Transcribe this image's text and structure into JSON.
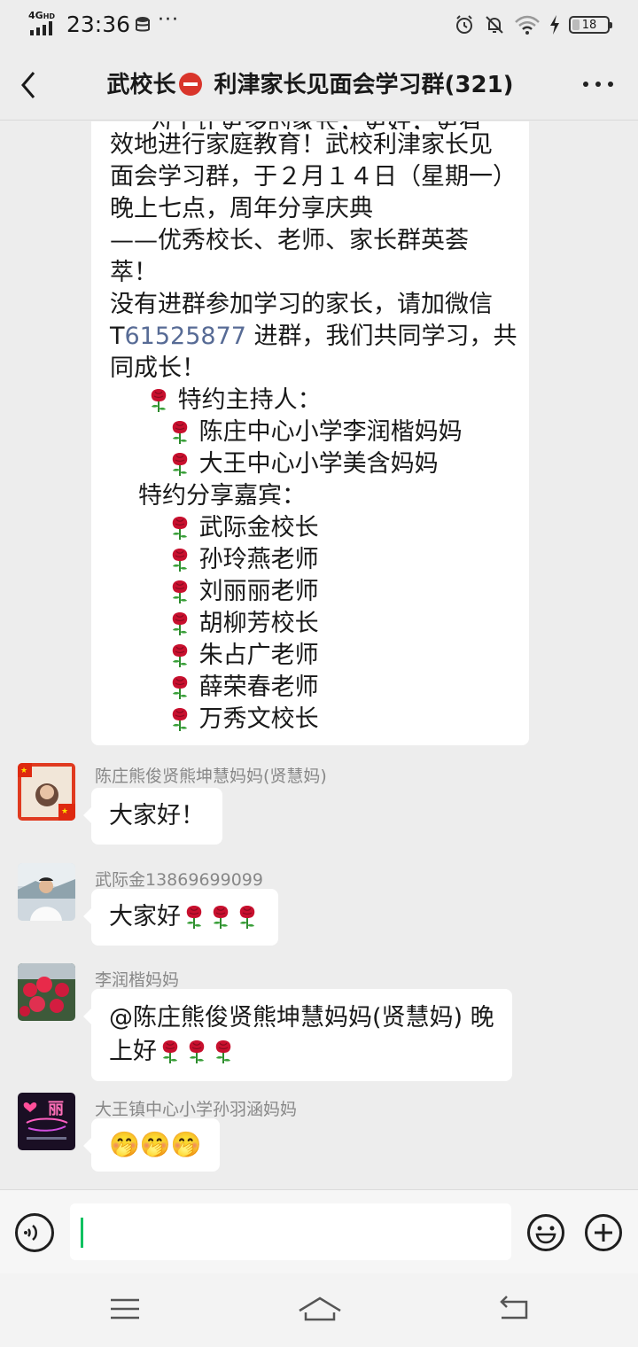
{
  "status_bar": {
    "network": "4G",
    "network_sup": "HD",
    "time": "23:36",
    "battery": "18",
    "battery_level": 0.18
  },
  "header": {
    "title_prefix": "武校长",
    "title_suffix": "利津家长见面会学习群(321)"
  },
  "announcement": {
    "lines": [
      "效地进行家庭教育！武校利津家长见",
      "面会学习群，于２月１４日（星期一）",
      "晚上七点，周年分享庆典",
      "——优秀校长、老师、家长群英荟",
      "萃！",
      "没有进群参加学习的家长，请加微信"
    ],
    "wechat_prefix": "T",
    "wechat_id": "61525877",
    "wechat_suffix": " 进群，我们共同学习，共",
    "line_after": "同成长！",
    "host_title": "特约主持人：",
    "hosts": [
      "陈庄中心小学李润楷妈妈",
      "大王中心小学美含妈妈"
    ],
    "guest_title": "特约分享嘉宾：",
    "guests": [
      "武际金校长",
      "孙玲燕老师",
      "刘丽丽老师",
      "胡柳芳校长",
      "朱占广老师",
      "薛荣春老师",
      "万秀文校长"
    ]
  },
  "messages": [
    {
      "sender": "陈庄熊俊贤熊坤慧妈妈(贤慧妈)",
      "text": "大家好！"
    },
    {
      "sender": "武际金13869699099",
      "text": "大家好"
    },
    {
      "sender": "李润楷妈妈",
      "text_line1": "@陈庄熊俊贤熊坤慧妈妈(贤慧妈) 晚",
      "text_line2": "上好"
    },
    {
      "sender": "大王镇中心小学孙羽涵妈妈",
      "text": "🤭🤭🤭",
      "avatar_text": "丽"
    }
  ],
  "input": {
    "value": ""
  },
  "colors": {
    "background": "#ededed",
    "bubble": "#ffffff",
    "link": "#576b95",
    "caret": "#07c160",
    "rose": "#c8102e"
  }
}
